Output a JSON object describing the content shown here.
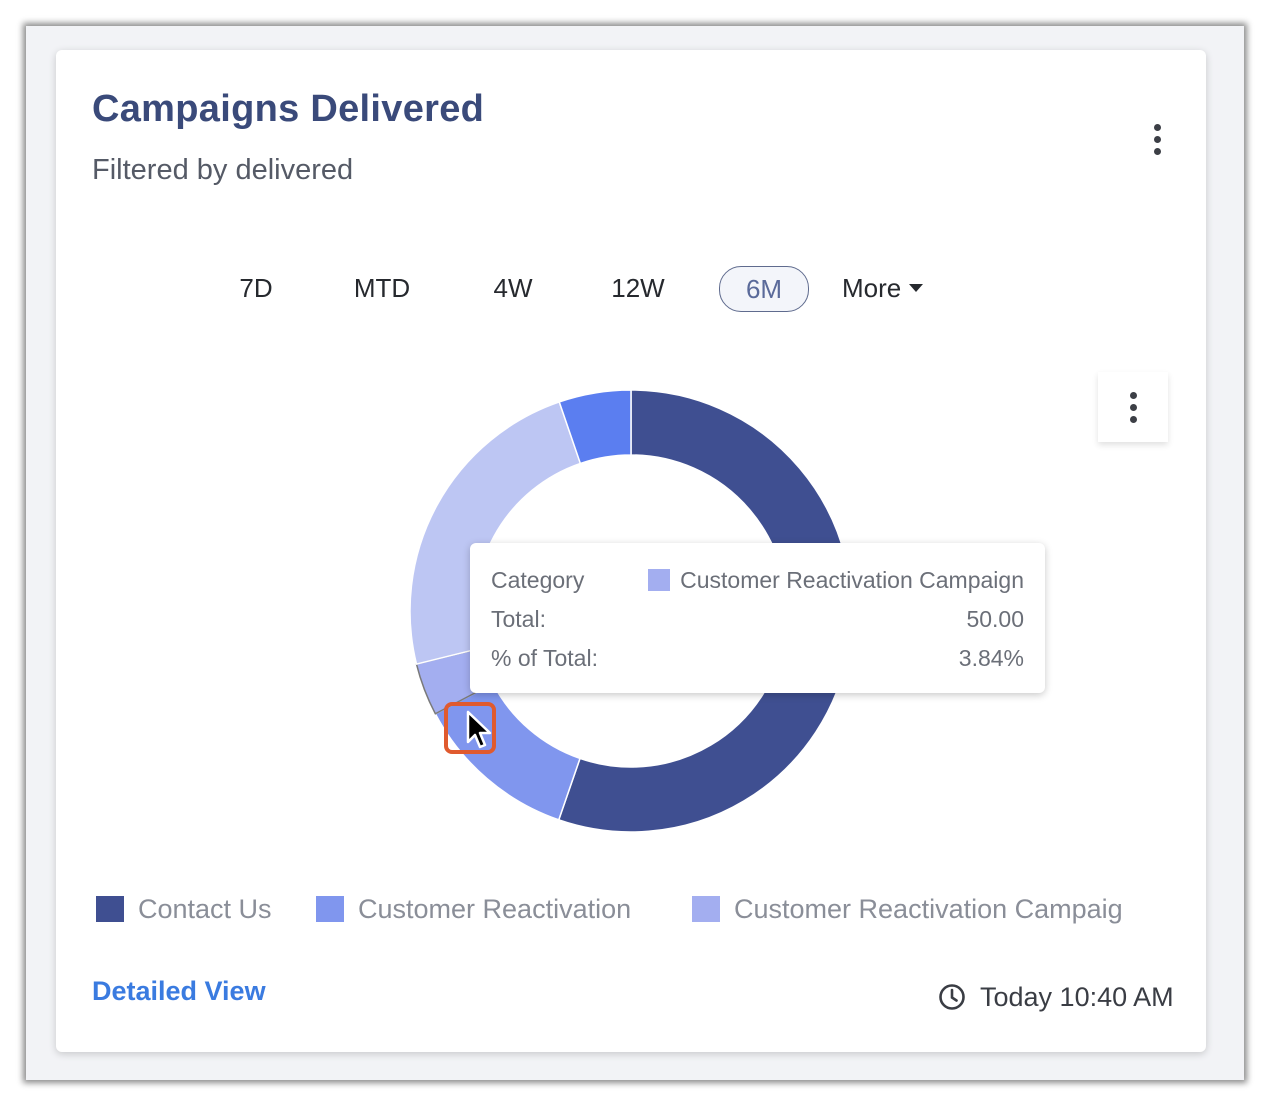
{
  "card": {
    "title": "Campaigns Delivered",
    "subtitle": "Filtered by delivered"
  },
  "tabs": [
    {
      "label": "7D",
      "active": false
    },
    {
      "label": "MTD",
      "active": false
    },
    {
      "label": "4W",
      "active": false
    },
    {
      "label": "12W",
      "active": false
    },
    {
      "label": "6M",
      "active": true
    },
    {
      "label": "More",
      "active": false
    }
  ],
  "colors": {
    "contact_us": "#3f4f91",
    "customer_reactivation": "#8096ee",
    "customer_reactivation_campaign": "#a3aef0",
    "light_segment": "#bdc6f3",
    "bright_segment": "#5b7ef0",
    "accent_link": "#3a7be0"
  },
  "tooltip": {
    "category_label": "Category",
    "category_value": "Customer Reactivation Campaign",
    "total_label": "Total:",
    "total_value": "50.00",
    "pct_label": "% of Total:",
    "pct_value": "3.84%"
  },
  "legend": [
    {
      "label": "Contact Us",
      "color": "#3f4f91"
    },
    {
      "label": "Customer Reactivation",
      "color": "#8096ee"
    },
    {
      "label": "Customer Reactivation Campaig",
      "color": "#a3aef0"
    }
  ],
  "footer": {
    "link_label": "Detailed View",
    "timestamp": "Today 10:40 AM",
    "clock_icon": "clock-icon"
  },
  "chart_data": {
    "type": "pie",
    "donut": true,
    "segments": [
      {
        "color": "#3f4f91",
        "percent": 55.3
      },
      {
        "color": "#8096ee",
        "percent": 12.0
      },
      {
        "color": "#a3aef0",
        "percent": 3.84,
        "highlighted": true
      },
      {
        "color": "#bdc6f3",
        "percent": 23.6
      },
      {
        "color": "#5b7ef0",
        "percent": 5.26
      }
    ]
  }
}
